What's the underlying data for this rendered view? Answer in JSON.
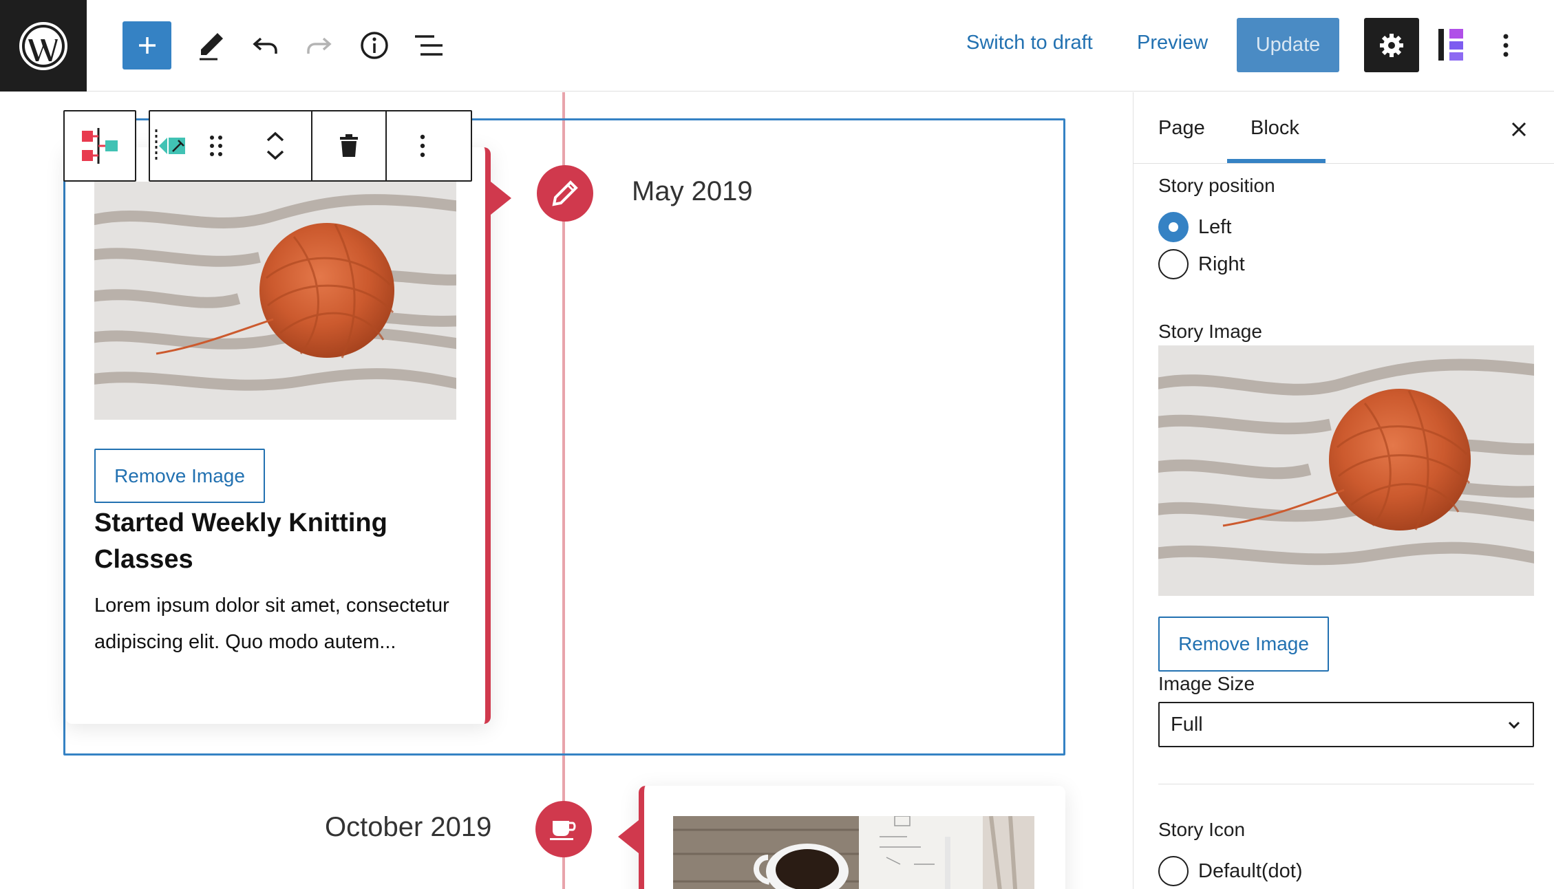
{
  "topbar": {
    "switch_to_draft": "Switch to draft",
    "preview": "Preview",
    "update": "Update"
  },
  "canvas": {
    "stories": [
      {
        "date": "May 2019",
        "title": "Started Weekly Knitting Classes",
        "excerpt": "Lorem ipsum dolor sit amet, consectetur adipiscing elit. Quo modo autem...",
        "remove_image_label": "Remove Image",
        "icon": "pencil-icon",
        "position": "left"
      },
      {
        "date": "October 2019",
        "icon": "coffee-cup-icon",
        "position": "right"
      }
    ]
  },
  "sidebar": {
    "tabs": [
      "Page",
      "Block"
    ],
    "active_tab": "Block",
    "story_position_label": "Story position",
    "position_options": [
      "Left",
      "Right"
    ],
    "selected_position": "Left",
    "story_image_label": "Story Image",
    "remove_image_label": "Remove Image",
    "image_size_label": "Image Size",
    "image_size_value": "Full",
    "story_icon_label": "Story Icon",
    "icon_option_default": "Default(dot)"
  },
  "colors": {
    "accent": "#d0394d",
    "primary": "#3582c4",
    "link": "#2271b1",
    "dark": "#1e1e1e"
  }
}
